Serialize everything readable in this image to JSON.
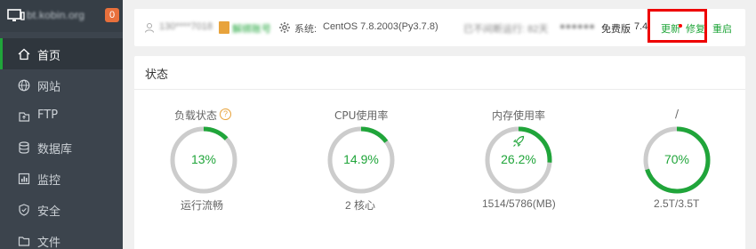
{
  "sidebar": {
    "host": "bt.kobin.org",
    "badge": "0",
    "items": [
      {
        "label": "首页",
        "icon": "home-icon"
      },
      {
        "label": "网站",
        "icon": "globe-icon"
      },
      {
        "label": "FTP",
        "icon": "ftp-icon"
      },
      {
        "label": "数据库",
        "icon": "database-icon"
      },
      {
        "label": "监控",
        "icon": "monitor-chart-icon"
      },
      {
        "label": "安全",
        "icon": "shield-icon"
      },
      {
        "label": "文件",
        "icon": "folder-icon"
      }
    ]
  },
  "topbar": {
    "user": "130****7018",
    "bind_label": "解绑账号",
    "system_label": "系统:",
    "system_value": "CentOS 7.8.2003(Py3.7.8)",
    "uptime": "已不间断运行: 82天",
    "blurred_extra": "●●●●●●",
    "edition": "免费版",
    "version": "7.4.",
    "update_label": "更新",
    "repair_label": "修复",
    "restart_label": "重启",
    "colors": {
      "link": "#20a53a",
      "highlight": "#ee0000"
    }
  },
  "status": {
    "title": "状态",
    "metrics": [
      {
        "title": "负载状态",
        "value": "13%",
        "fraction": 0.13,
        "sub": "运行流畅",
        "has_help": true
      },
      {
        "title": "CPU使用率",
        "value": "14.9%",
        "fraction": 0.149,
        "sub": "2 核心"
      },
      {
        "title": "内存使用率",
        "value": "26.2%",
        "fraction": 0.262,
        "sub": "1514/5786(MB)",
        "icon": "rocket-icon"
      },
      {
        "title": "/",
        "value": "70%",
        "fraction": 0.7,
        "sub": "2.5T/3.5T"
      }
    ],
    "colors": {
      "track": "#cccccc",
      "fill": "#20a53a"
    }
  }
}
